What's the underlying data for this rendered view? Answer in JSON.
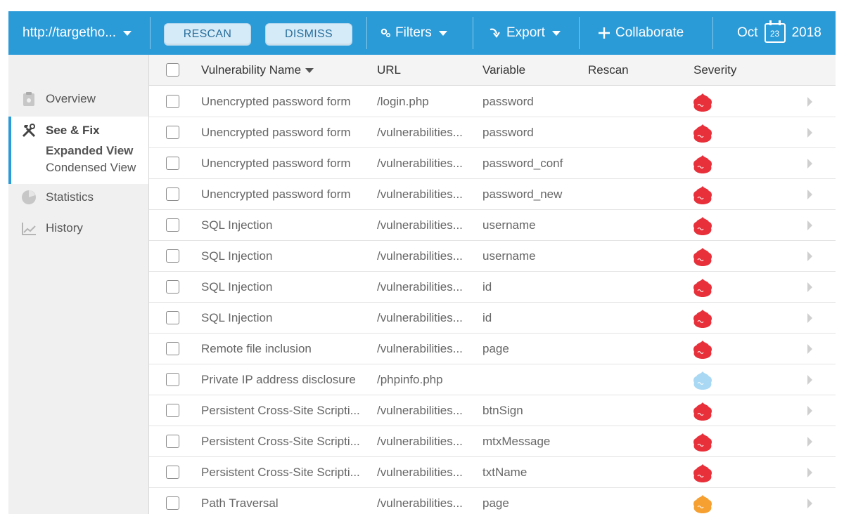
{
  "topbar": {
    "target_label": "http://targetho...",
    "rescan_label": "RESCAN",
    "dismiss_label": "DISMISS",
    "filters_label": "Filters",
    "export_label": "Export",
    "collaborate_label": "Collaborate",
    "date_month": "Oct",
    "date_day": "23",
    "date_year": "2018",
    "accent_color": "#2b9bd8"
  },
  "sidebar": {
    "overview": {
      "label": "Overview",
      "icon": "clipboard-icon"
    },
    "see_fix": {
      "label": "See & Fix",
      "icon": "tools-icon"
    },
    "expanded_view": "Expanded View",
    "condensed_view": "Condensed View",
    "statistics": {
      "label": "Statistics",
      "icon": "pie-chart-icon"
    },
    "history": {
      "label": "History",
      "icon": "line-chart-icon"
    }
  },
  "table": {
    "columns": {
      "name": "Vulnerability Name",
      "url": "URL",
      "variable": "Variable",
      "rescan": "Rescan",
      "severity": "Severity"
    },
    "rows": [
      {
        "name": "Unencrypted password form",
        "url": "/login.php",
        "variable": "password",
        "severity": "high"
      },
      {
        "name": "Unencrypted password form",
        "url": "/vulnerabilities...",
        "variable": "password",
        "severity": "high"
      },
      {
        "name": "Unencrypted password form",
        "url": "/vulnerabilities...",
        "variable": "password_conf",
        "severity": "high"
      },
      {
        "name": "Unencrypted password form",
        "url": "/vulnerabilities...",
        "variable": "password_new",
        "severity": "high"
      },
      {
        "name": "SQL Injection",
        "url": "/vulnerabilities...",
        "variable": "username",
        "severity": "high"
      },
      {
        "name": "SQL Injection",
        "url": "/vulnerabilities...",
        "variable": "username",
        "severity": "high"
      },
      {
        "name": "SQL Injection",
        "url": "/vulnerabilities...",
        "variable": "id",
        "severity": "high"
      },
      {
        "name": "SQL Injection",
        "url": "/vulnerabilities...",
        "variable": "id",
        "severity": "high"
      },
      {
        "name": "Remote file inclusion",
        "url": "/vulnerabilities...",
        "variable": "page",
        "severity": "high"
      },
      {
        "name": "Private IP address disclosure",
        "url": "/phpinfo.php",
        "variable": "",
        "severity": "info"
      },
      {
        "name": "Persistent Cross-Site Scripti...",
        "url": "/vulnerabilities...",
        "variable": "btnSign",
        "severity": "high"
      },
      {
        "name": "Persistent Cross-Site Scripti...",
        "url": "/vulnerabilities...",
        "variable": "mtxMessage",
        "severity": "high"
      },
      {
        "name": "Persistent Cross-Site Scripti...",
        "url": "/vulnerabilities...",
        "variable": "txtName",
        "severity": "high"
      },
      {
        "name": "Path Traversal",
        "url": "/vulnerabilities...",
        "variable": "page",
        "severity": "medium"
      }
    ],
    "severity_colors": {
      "high": "#e8303a",
      "info": "#a8d8f4",
      "medium": "#f5a030"
    }
  }
}
